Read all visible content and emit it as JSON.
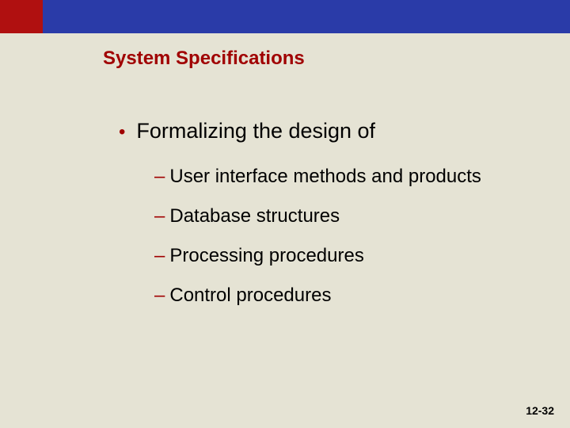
{
  "title": "System Specifications",
  "bullet": {
    "text": "Formalizing the design of"
  },
  "sub_items": [
    "User interface methods and products",
    "Database structures",
    "Processing procedures",
    "Control procedures"
  ],
  "page_number": "12-32"
}
